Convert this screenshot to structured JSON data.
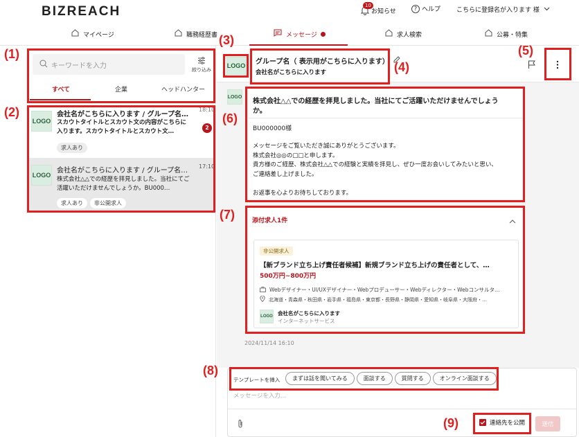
{
  "header": {
    "brand": "BIZREACH",
    "notification_count": "10",
    "notification_label": "お知らせ",
    "help_label": "ヘルプ",
    "account_label": "こちらに登録名が入ります 様"
  },
  "nav": {
    "items": [
      {
        "label": "マイページ"
      },
      {
        "label": "職務経歴書"
      },
      {
        "label": "メッセージ"
      },
      {
        "label": "求人検索"
      },
      {
        "label": "公募・特集"
      }
    ]
  },
  "sidebar": {
    "search_placeholder": "キーワードを入力",
    "filter_label": "絞り込み",
    "tabs": [
      {
        "label": "すべて"
      },
      {
        "label": "企業"
      },
      {
        "label": "ヘッドハンター"
      }
    ],
    "messages": [
      {
        "title": "会社名がこちらに入ります / グループ名…",
        "time": "18:10",
        "preview": "スカウトタイトルとスカウト文の内容がこちらに入ります。スカウトタイトルとスカウト文…",
        "tags": [
          "求人あり"
        ],
        "badge": "2",
        "logo": "LOGO"
      },
      {
        "title": "会社名がこちらに入ります / グループ名…",
        "time": "17:10",
        "preview": "株式会社△△での経歴を拝見しました。当社にてご活躍いただけませんでしょうか。BU000…",
        "tags": [
          "求人あり",
          "非公開求人"
        ],
        "logo": "LOGO"
      }
    ]
  },
  "conversation": {
    "logo": "LOGO",
    "group_name": "グループ名（ 表示用がこちらに入ります）",
    "company_name": "会社名がこちらに入ります",
    "message_title": "株式会社△△での経歴を拝見しました。当社にてご活躍いただけませんでしょうか。",
    "recipient": "BU000000様",
    "body_lines": [
      "メッセージをご覧いただき誠にありがとうございます。",
      "株式会社◎◎の□□と申します。",
      "貴方様のご経歴、株式会社△△での経験と実績を拝見し、ぜひ一度お会いしてみたいと思い、",
      "ご連絡差し上げました。",
      "",
      "お返事を心よりお待ちしております。"
    ],
    "attachment_header": "添付求人1件",
    "job": {
      "tag": "非公開求人",
      "title": "【新ブランド立ち上げ責任者候補】新規ブランド立ち上げの責任者として、…",
      "salary": "500万円~800万円",
      "occupations": "Webデザイナー・UI/UXデザイナー・Webプロデューサー・Webディレクター・Webコンサルタ…",
      "locations": "北海道・青森県・秋田県・岩手県・福島県・東京都・長野県・静岡県・愛知県・岐阜県・大阪府・…",
      "company": "会社名がこちらに入ります",
      "industry": "インターネットサービス",
      "logo": "LOGO"
    },
    "timestamp": "2024/11/14 16:10"
  },
  "composer": {
    "template_label": "テンプレートを挿入",
    "templates": [
      "まずは話を聞いてみる",
      "面談する",
      "質問する",
      "オンライン面談する"
    ],
    "placeholder": "メッセージを入力…",
    "publish_contact_label": "連絡先を公開",
    "send_label": "送信"
  },
  "annotations": [
    "(1)",
    "(2)",
    "(3)",
    "(4)",
    "(5)",
    "(6)",
    "(7)",
    "(8)",
    "(9)"
  ],
  "colors": {
    "accent": "#b8161c",
    "annotation_red": "#e0201f",
    "selected_row": "#e8e8e8",
    "logo_bg": "#d9eee0"
  }
}
